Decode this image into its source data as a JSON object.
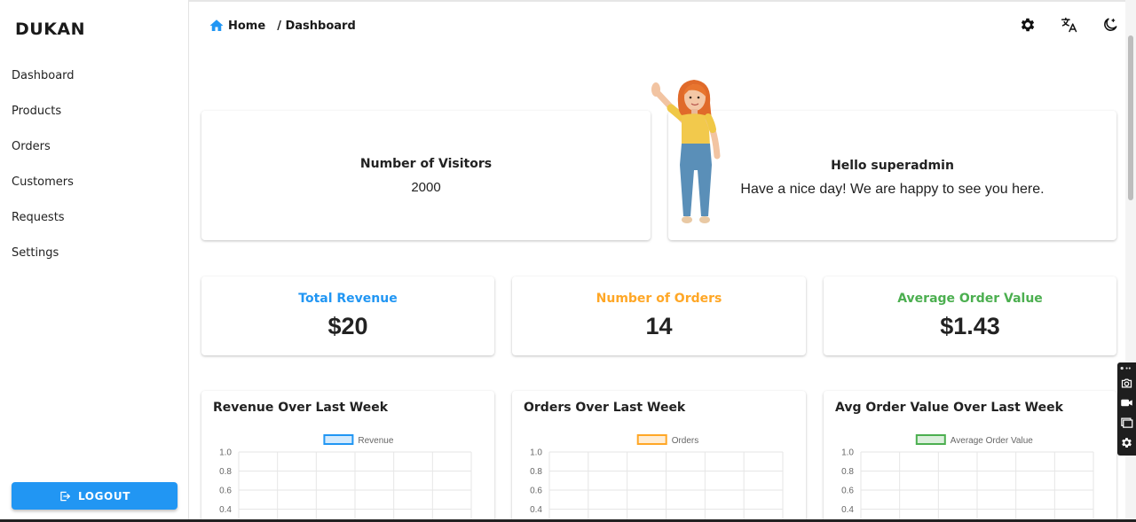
{
  "brand": "DUKAN",
  "sidebar": {
    "items": [
      {
        "label": "Dashboard"
      },
      {
        "label": "Products"
      },
      {
        "label": "Orders"
      },
      {
        "label": "Customers"
      },
      {
        "label": "Requests"
      },
      {
        "label": "Settings"
      }
    ],
    "logout_label": "LOGOUT"
  },
  "breadcrumb": {
    "home": "Home",
    "current": "/ Dashboard"
  },
  "header_icons": [
    "settings-icon",
    "translate-icon",
    "dark-mode-icon"
  ],
  "visitors": {
    "title": "Number of Visitors",
    "value": "2000"
  },
  "greeting": {
    "title": "Hello superadmin",
    "message": "Have a nice day! We are happy to see you here."
  },
  "stats": [
    {
      "label": "Total Revenue",
      "value": "$20",
      "color": "#2196f3"
    },
    {
      "label": "Number of Orders",
      "value": "14",
      "color": "#ffa726"
    },
    {
      "label": "Average Order Value",
      "value": "$1.43",
      "color": "#4caf50"
    }
  ],
  "chart_data": [
    {
      "type": "line",
      "title": "Revenue Over Last Week",
      "series": [
        {
          "name": "Revenue",
          "values": []
        }
      ],
      "y_ticks": [
        "1.0",
        "0.8",
        "0.6",
        "0.4"
      ],
      "ylim": [
        0,
        1.0
      ],
      "grid": true,
      "legend": "top-center",
      "color": "#2196f3"
    },
    {
      "type": "line",
      "title": "Orders Over Last Week",
      "series": [
        {
          "name": "Orders",
          "values": []
        }
      ],
      "y_ticks": [
        "1.0",
        "0.8",
        "0.6",
        "0.4"
      ],
      "ylim": [
        0,
        1.0
      ],
      "grid": true,
      "legend": "top-center",
      "color": "#ffa726"
    },
    {
      "type": "line",
      "title": "Avg Order Value Over Last Week",
      "series": [
        {
          "name": "Average Order Value",
          "values": []
        }
      ],
      "y_ticks": [
        "1.0",
        "0.8",
        "0.6",
        "0.4"
      ],
      "ylim": [
        0,
        1.0
      ],
      "grid": true,
      "legend": "top-center",
      "color": "#4caf50"
    }
  ]
}
